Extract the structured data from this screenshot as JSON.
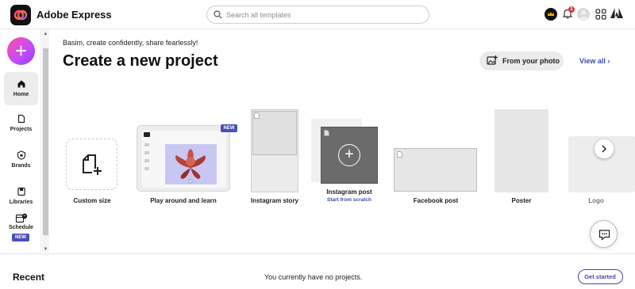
{
  "app": {
    "title": "Adobe Express",
    "logo_icon": "adobe-express-logo"
  },
  "header": {
    "search_placeholder": "Search all templates",
    "notification_count": "1",
    "icons": [
      "search-icon",
      "crown-icon",
      "bell-icon",
      "avatar",
      "apps-grid-icon",
      "adobe-icon"
    ]
  },
  "sidebar": {
    "create_label": "+",
    "items": [
      {
        "label": "Home",
        "icon": "home-icon",
        "active": true
      },
      {
        "label": "Projects",
        "icon": "projects-icon"
      },
      {
        "label": "Brands",
        "icon": "brands-icon"
      },
      {
        "label": "Libraries",
        "icon": "libraries-icon"
      },
      {
        "label": "Schedule",
        "icon": "calendar-icon",
        "badge": "NEW"
      }
    ]
  },
  "main": {
    "greeting": "Basim, create confidently, share fearlessly!",
    "title": "Create a new project",
    "photo_button": "From your photo",
    "view_all": "View all",
    "cards": [
      {
        "label": "Custom size"
      },
      {
        "label": "Play around and learn",
        "badge": "NEW"
      },
      {
        "label": "Instagram story"
      },
      {
        "label": "Instagram post",
        "sub": "Start from scratch"
      },
      {
        "label": "Facebook post"
      },
      {
        "label": "Poster"
      },
      {
        "label": "Logo"
      }
    ]
  },
  "recent": {
    "title": "Recent",
    "empty_text": "You currently have no projects.",
    "button": "Get started"
  },
  "colors": {
    "accent": "#3d4bb0",
    "badge": "#4a4fb5",
    "notification": "#d7373f"
  }
}
